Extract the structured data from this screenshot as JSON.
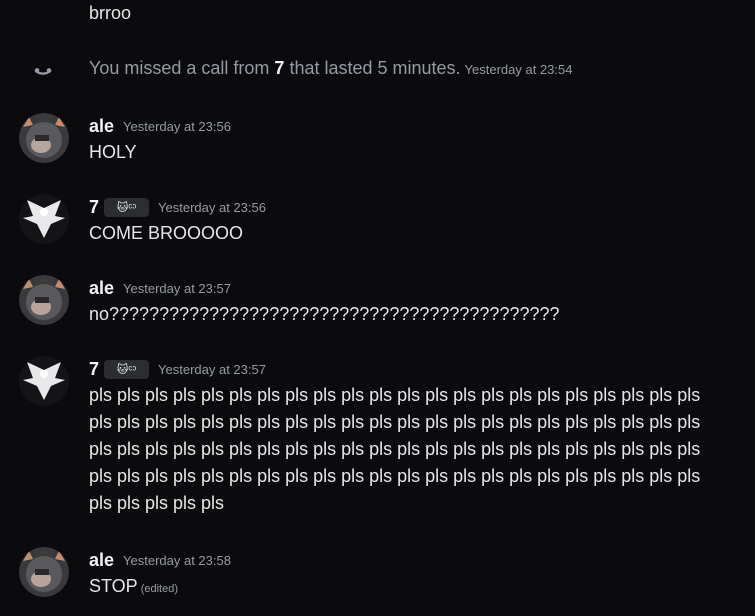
{
  "colors": {
    "background": "#0b0b0d",
    "text": "#e6e6e8",
    "muted": "#949ba4",
    "username": "#f2f3f5"
  },
  "top_fragment": "brroo",
  "missed_call": {
    "icon": "phone-icon",
    "prefix": "You missed a call from ",
    "caller": "7",
    "suffix": " that lasted 5 minutes.",
    "timestamp": "Yesterday at 23:54"
  },
  "messages": [
    {
      "author": "ale",
      "avatar": "ale-avatar",
      "timestamp": "Yesterday at 23:56",
      "text": "HOLY"
    },
    {
      "author": "7",
      "tag": "🐱ᶜᵓ",
      "avatar": "angel-avatar",
      "timestamp": "Yesterday at 23:56",
      "text": "COME BROOOOO"
    },
    {
      "author": "ale",
      "avatar": "ale-avatar",
      "timestamp": "Yesterday at 23:57",
      "text": "no?????????????????????????????????????????????"
    },
    {
      "author": "7",
      "tag": "🐱ᶜᵓ",
      "avatar": "angel-avatar",
      "timestamp": "Yesterday at 23:57",
      "lines": [
        "pls pls pls pls pls pls pls pls pls pls pls pls pls pls pls pls pls pls pls pls pls pls",
        "pls pls pls pls pls pls pls pls pls pls pls pls pls pls pls pls pls pls pls pls pls pls",
        "pls pls pls pls pls pls pls pls pls pls pls pls pls pls pls pls pls pls pls pls pls pls",
        "pls pls pls pls pls pls pls pls pls pls pls pls pls pls pls pls pls pls pls pls pls pls",
        "pls pls pls pls pls"
      ]
    },
    {
      "author": "ale",
      "avatar": "ale-avatar",
      "timestamp": "Yesterday at 23:58",
      "text": "STOP",
      "edited": "(edited)"
    }
  ]
}
